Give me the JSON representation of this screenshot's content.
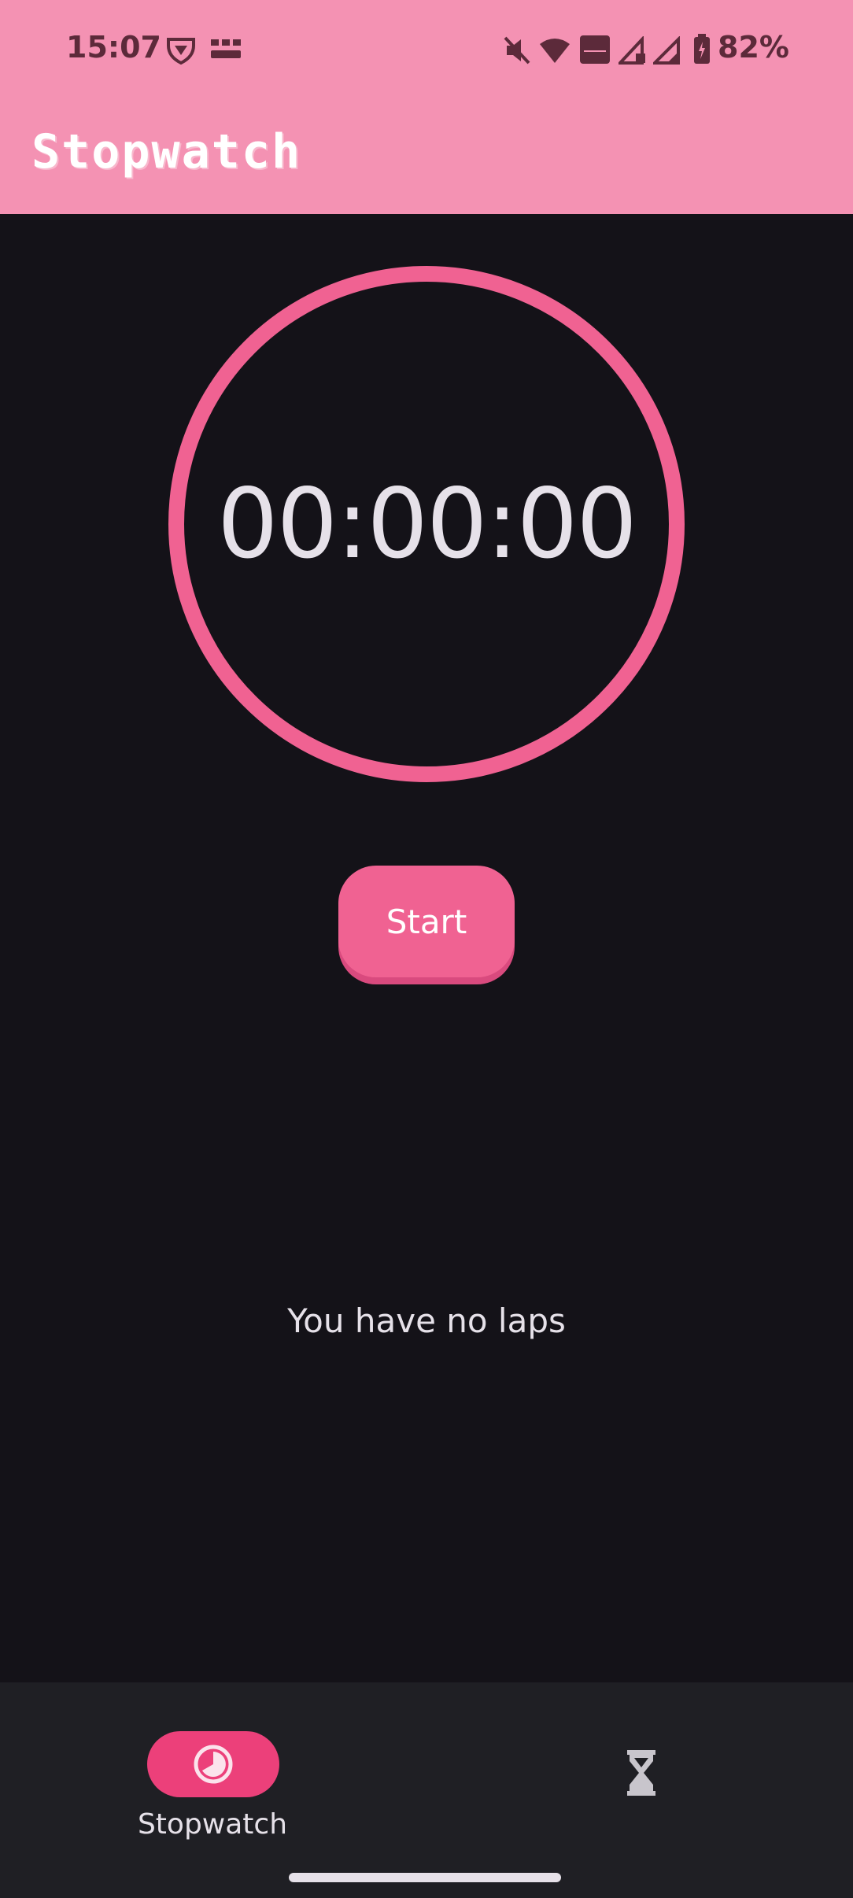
{
  "status_bar": {
    "time": "15:07",
    "battery": "82%",
    "icons": [
      "vpn-shield-icon",
      "temu-notification-icon",
      "mute-icon",
      "wifi-icon",
      "vowifi-icon",
      "signal-r-icon",
      "signal-icon",
      "battery-charging-icon"
    ]
  },
  "app_bar": {
    "title": "Stopwatch"
  },
  "timer": {
    "display": "00:00:00"
  },
  "controls": {
    "start_label": "Start"
  },
  "laps": {
    "empty_message": "You have no laps"
  },
  "bottom_nav": {
    "items": [
      {
        "label": "Stopwatch",
        "icon": "stopwatch-icon",
        "selected": true
      },
      {
        "label": "",
        "icon": "hourglass-icon",
        "selected": false
      }
    ]
  },
  "colors": {
    "header": "#f492b3",
    "accent": "#f06292",
    "background": "#141218",
    "nav_background": "#1f1f24"
  }
}
